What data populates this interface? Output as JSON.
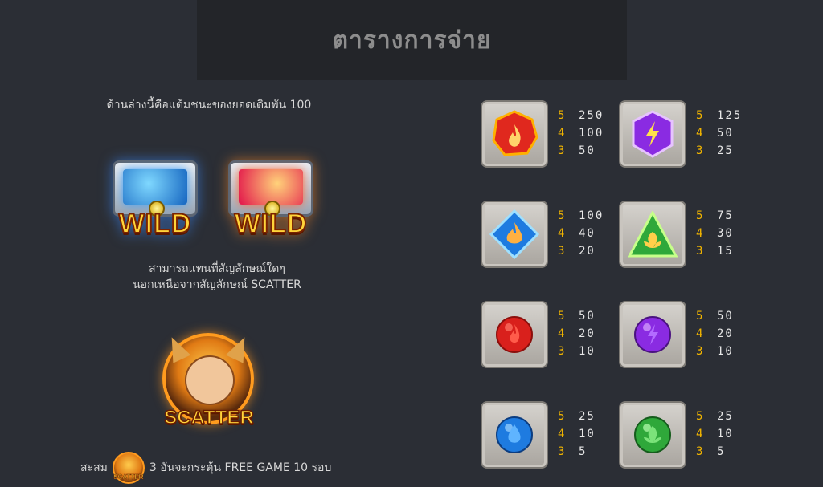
{
  "header": {
    "title": "ตารางการจ่าย"
  },
  "intro_text": "ด้านล่างนี้คือแต้มชนะของยอดเดิมพัน 100",
  "wild": {
    "label": "WILD",
    "description_line1": "สามารถแทนที่สัญลักษณ์ใดๆ",
    "description_line2": "นอกเหนือจากสัญลักษณ์ SCATTER"
  },
  "scatter": {
    "label": "SCATTER",
    "mini_label": "SCATTER",
    "prefix": "สะสม",
    "suffix": "3 อันจะกระตุ้น FREE GAME 10 รอบ"
  },
  "symbols": [
    {
      "icon": "red-fire-gem-icon",
      "color": "#e0281e",
      "pays": [
        {
          "count": "5",
          "value": "250"
        },
        {
          "count": "4",
          "value": "100"
        },
        {
          "count": "3",
          "value": "50"
        }
      ]
    },
    {
      "icon": "purple-lightning-gem-icon",
      "color": "#8a2be2",
      "pays": [
        {
          "count": "5",
          "value": "125"
        },
        {
          "count": "4",
          "value": "50"
        },
        {
          "count": "3",
          "value": "25"
        }
      ]
    },
    {
      "icon": "blue-water-gem-icon",
      "color": "#1e7be0",
      "pays": [
        {
          "count": "5",
          "value": "100"
        },
        {
          "count": "4",
          "value": "40"
        },
        {
          "count": "3",
          "value": "20"
        }
      ]
    },
    {
      "icon": "green-leaf-gem-icon",
      "color": "#2fa83a",
      "pays": [
        {
          "count": "5",
          "value": "75"
        },
        {
          "count": "4",
          "value": "30"
        },
        {
          "count": "3",
          "value": "15"
        }
      ]
    },
    {
      "icon": "red-fire-orb-icon",
      "color": "#e0281e",
      "pays": [
        {
          "count": "5",
          "value": "50"
        },
        {
          "count": "4",
          "value": "20"
        },
        {
          "count": "3",
          "value": "10"
        }
      ]
    },
    {
      "icon": "purple-lightning-orb-icon",
      "color": "#8a2be2",
      "pays": [
        {
          "count": "5",
          "value": "50"
        },
        {
          "count": "4",
          "value": "20"
        },
        {
          "count": "3",
          "value": "10"
        }
      ]
    },
    {
      "icon": "blue-water-orb-icon",
      "color": "#1e7be0",
      "pays": [
        {
          "count": "5",
          "value": "25"
        },
        {
          "count": "4",
          "value": "10"
        },
        {
          "count": "3",
          "value": "5"
        }
      ]
    },
    {
      "icon": "green-leaf-orb-icon",
      "color": "#2fa83a",
      "pays": [
        {
          "count": "5",
          "value": "25"
        },
        {
          "count": "4",
          "value": "10"
        },
        {
          "count": "3",
          "value": "5"
        }
      ]
    }
  ]
}
